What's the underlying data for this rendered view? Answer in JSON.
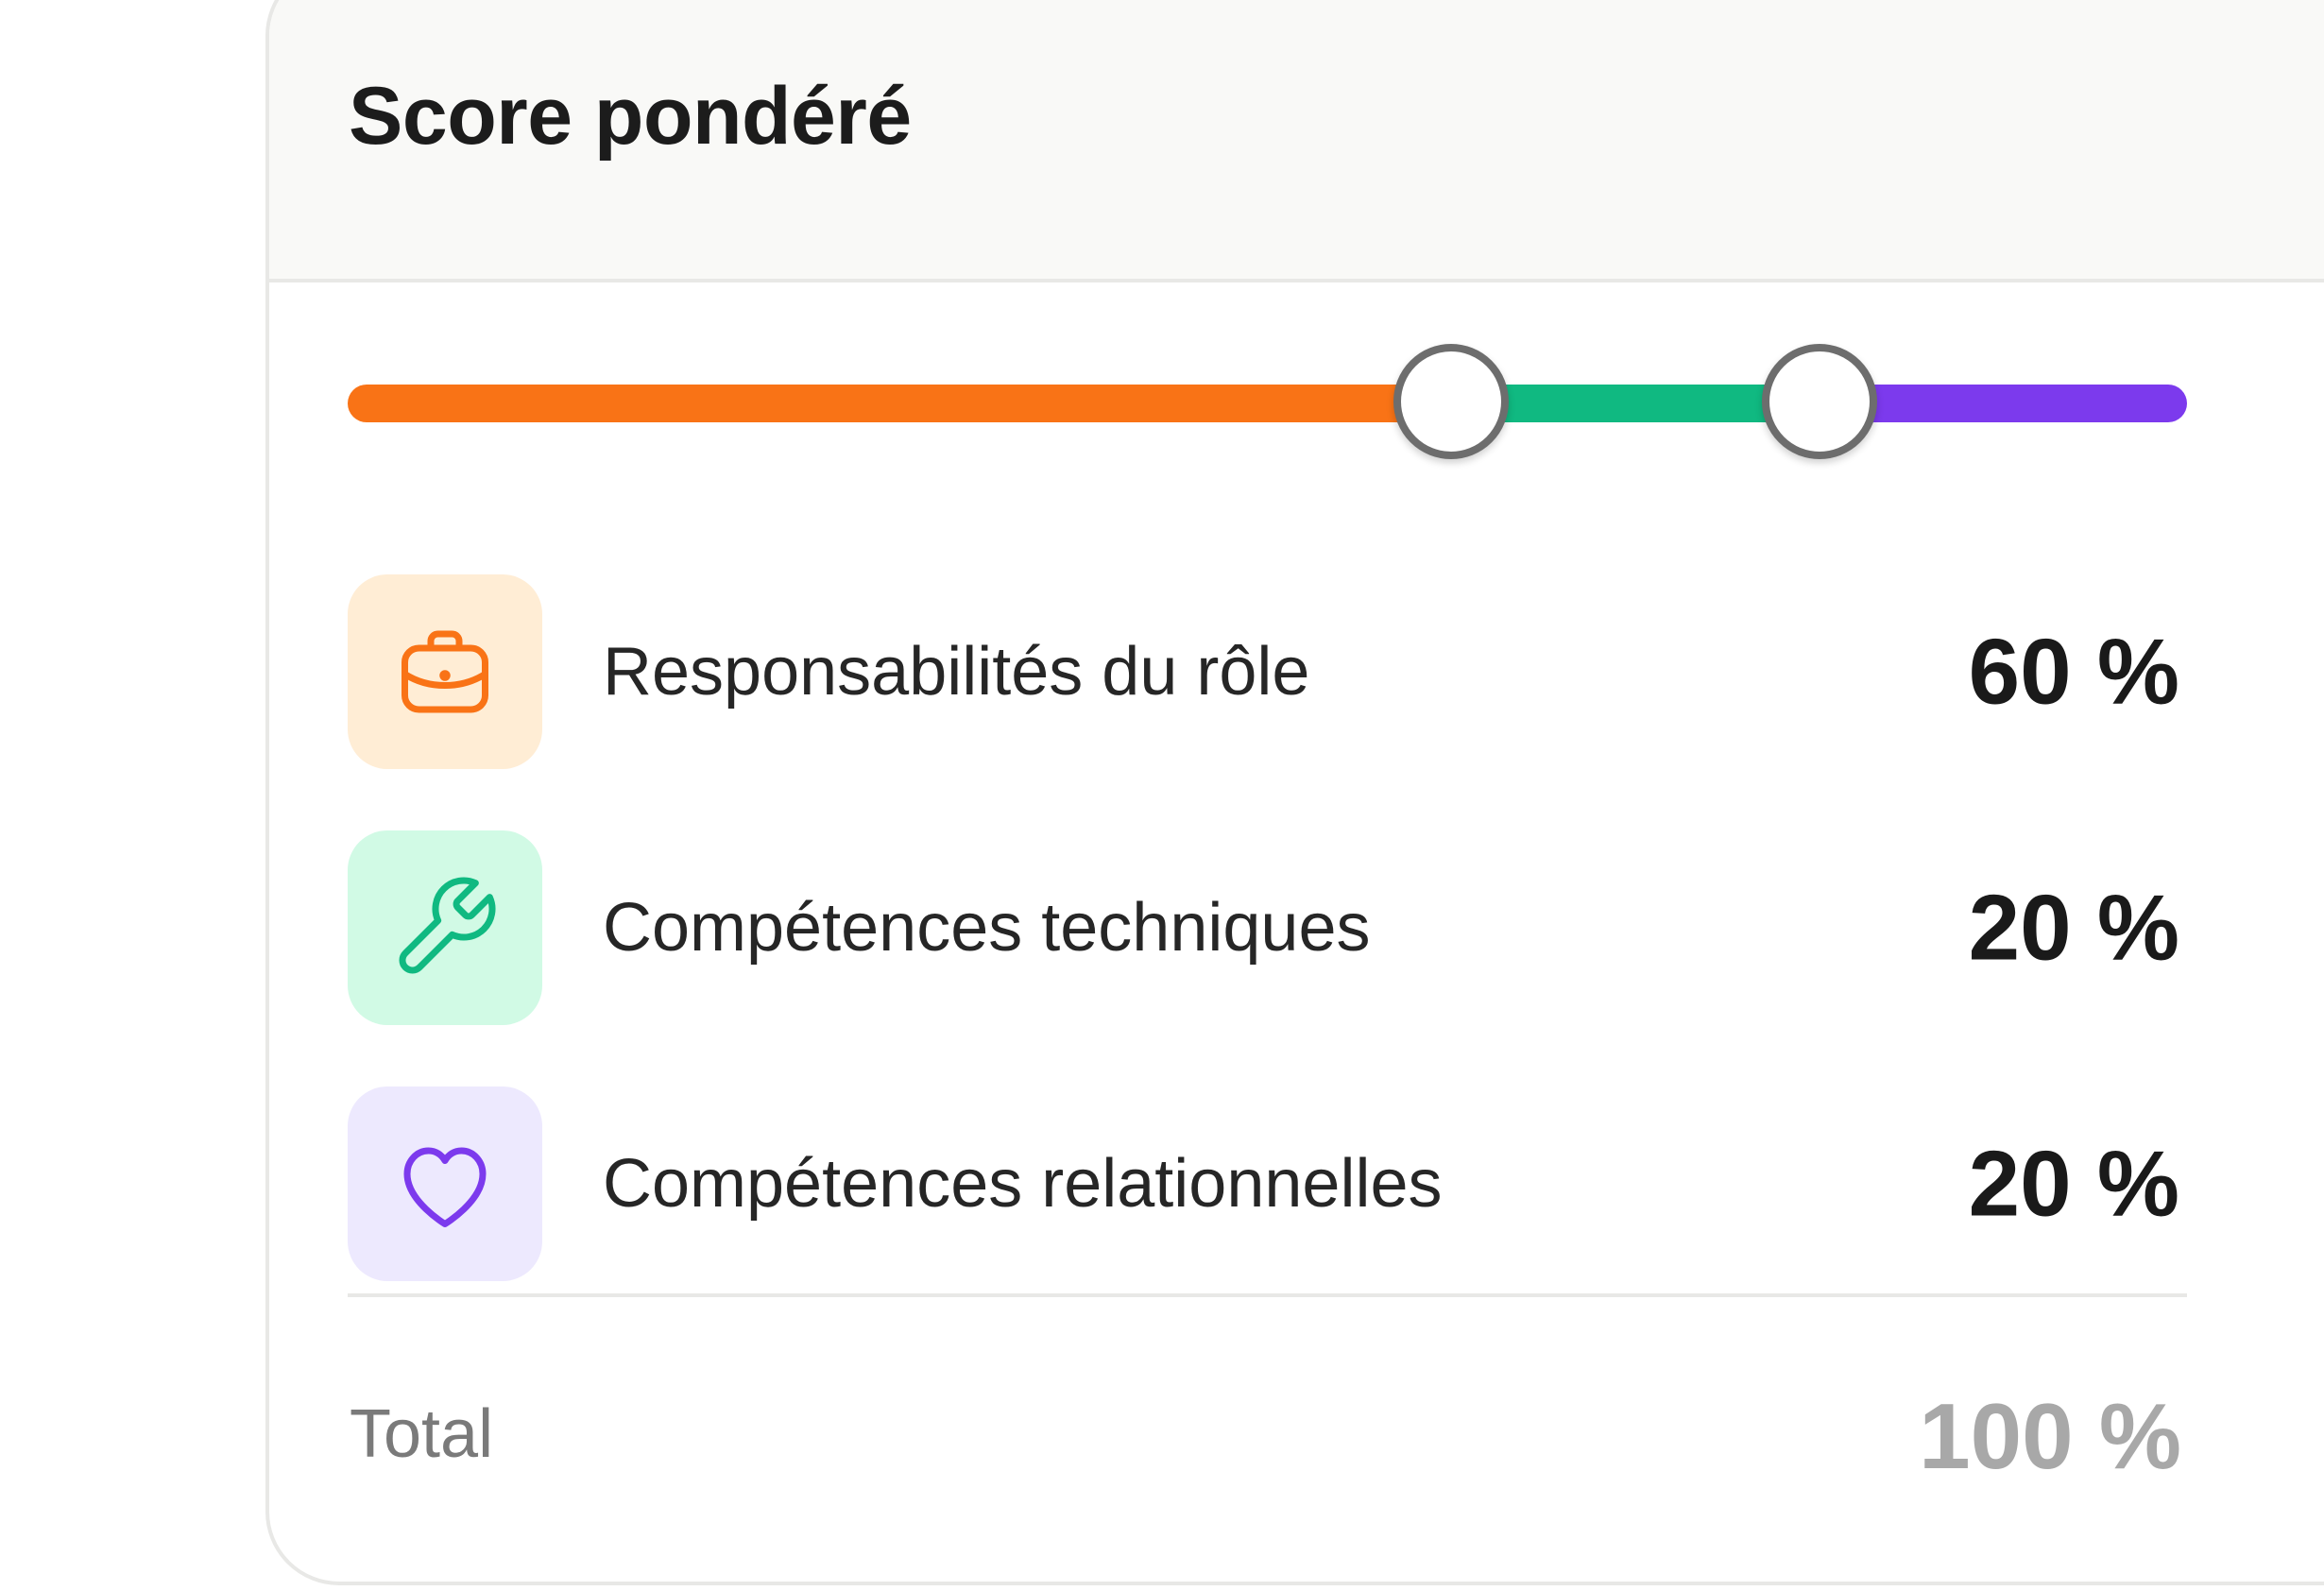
{
  "panel": {
    "title": "Score pondéré"
  },
  "slider": {
    "split_points_percent": [
      60,
      80
    ],
    "segment_colors": [
      "#f97316",
      "#10b981",
      "#7c3aed"
    ]
  },
  "rows": [
    {
      "icon": "briefcase-icon",
      "label": "Responsabilités du rôle",
      "value": "60 %",
      "icon_color": "#f97316",
      "icon_bg": "#ffedd5"
    },
    {
      "icon": "wrench-icon",
      "label": "Compétences techniques",
      "value": "20 %",
      "icon_color": "#10b981",
      "icon_bg": "#d1fae5"
    },
    {
      "icon": "heart-icon",
      "label": "Compétences relationnelles",
      "value": "20 %",
      "icon_color": "#7c3aed",
      "icon_bg": "#ede9fe"
    }
  ],
  "total": {
    "label": "Total",
    "value": "100 %"
  }
}
